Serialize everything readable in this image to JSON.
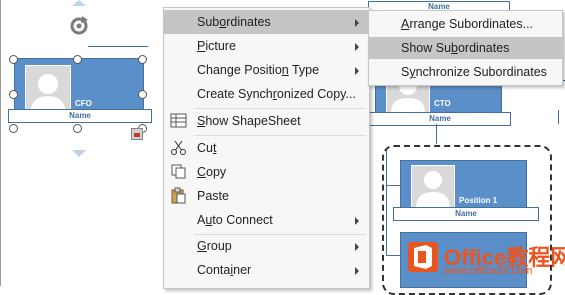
{
  "org": {
    "cfo": {
      "title": "CFO",
      "name": "Name"
    },
    "second": {
      "title": "CTO",
      "name": "Name",
      "top_name": "Name"
    },
    "position": {
      "title": "Position 1",
      "name": "Name"
    }
  },
  "context_menu": {
    "items": [
      {
        "label": "Subordinates",
        "accel": "S",
        "has_submenu": true,
        "icon": "",
        "active": true
      },
      {
        "label": "Picture",
        "accel": "P",
        "has_submenu": true,
        "icon": ""
      },
      {
        "label": "Change Position Type",
        "accel": "n",
        "has_submenu": true,
        "icon": ""
      },
      {
        "label": "Create Synchronized Copy...",
        "accel": "r",
        "has_submenu": false,
        "icon": ""
      },
      {
        "label": "Show ShapeSheet",
        "accel": "S",
        "has_submenu": false,
        "icon": "shapesheet-icon"
      },
      {
        "label": "Cut",
        "accel": "t",
        "has_submenu": false,
        "icon": "scissors-icon"
      },
      {
        "label": "Copy",
        "accel": "C",
        "has_submenu": false,
        "icon": "copy-icon"
      },
      {
        "label": "Paste",
        "accel": "",
        "has_submenu": false,
        "icon": "paste-icon"
      },
      {
        "label": "Auto Connect",
        "accel": "u",
        "has_submenu": true,
        "icon": ""
      },
      {
        "label": "Group",
        "accel": "G",
        "has_submenu": true,
        "icon": ""
      },
      {
        "label": "Container",
        "accel": "i",
        "has_submenu": true,
        "icon": ""
      }
    ]
  },
  "submenu": {
    "items": [
      {
        "label": "Arrange Subordinates...",
        "active": false
      },
      {
        "label": "Show Subordinates",
        "active": true
      },
      {
        "label": "Synchronize Subordinates",
        "active": false
      }
    ]
  },
  "watermark": {
    "title": "Office教程网",
    "url": "www.office26.com"
  },
  "colors": {
    "shape_fill": "#5b8fc9",
    "shape_border": "#41719c",
    "menu_hover": "#c5c5c5",
    "watermark": "#e9541f"
  }
}
